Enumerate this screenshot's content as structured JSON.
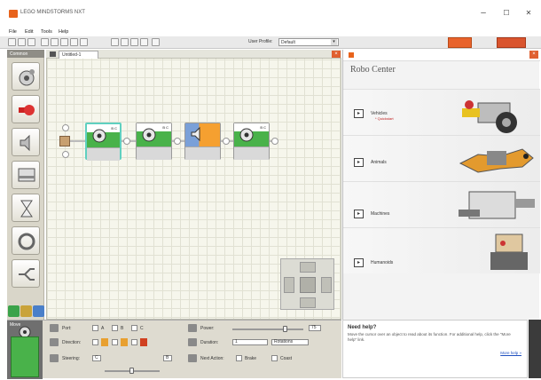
{
  "window": {
    "title": "LEGO MINDSTORMS NXT",
    "minimize": "–",
    "maximize": "☐",
    "close": "✕"
  },
  "menu": [
    "File",
    "Edit",
    "Tools",
    "Help"
  ],
  "toolbar": {
    "user_profile_label": "User Profile:",
    "user_profile_value": "Default"
  },
  "palette": {
    "header": "Common",
    "items": [
      "move",
      "record-play",
      "sound",
      "display",
      "wait",
      "loop",
      "switch"
    ]
  },
  "canvas": {
    "tab_label": "Untitled-1",
    "block_icons": [
      "motor-icon",
      "motor-icon",
      "sound-icon",
      "motor-icon"
    ],
    "block_ports": [
      "B C",
      "B C",
      "",
      "B C"
    ],
    "selected_index": 0
  },
  "robo_center": {
    "title": "Robo Center",
    "items": [
      {
        "label": "Vehicles",
        "sub": "* Quickstart",
        "btn": "▸"
      },
      {
        "label": "Animals",
        "sub": "",
        "btn": "▸"
      },
      {
        "label": "Machines",
        "sub": "",
        "btn": "▸"
      },
      {
        "label": "Humanoids",
        "sub": "",
        "btn": "▸"
      }
    ]
  },
  "config": {
    "block_label": "Move",
    "port_label": "Port:",
    "ports": [
      "A",
      "B",
      "C"
    ],
    "direction_label": "Direction:",
    "steering_label": "Steering:",
    "steering_left": "C",
    "steering_right": "B",
    "power_label": "Power:",
    "power_value": "75",
    "power_fraction": 0.75,
    "duration_label": "Duration:",
    "duration_value": "1",
    "duration_unit": "Rotations",
    "next_action_label": "Next Action:",
    "brake_label": "Brake",
    "coast_label": "Coast"
  },
  "help": {
    "title": "Need help?",
    "text": "Move the cursor over an object to read about its function. For additional help, click the \"More help\" link.",
    "link": "More help »"
  },
  "colors": {
    "accent_orange": "#e8631c",
    "block_green": "#49b24a",
    "block_orange": "#f5a030",
    "selection": "#5fd0c0"
  }
}
